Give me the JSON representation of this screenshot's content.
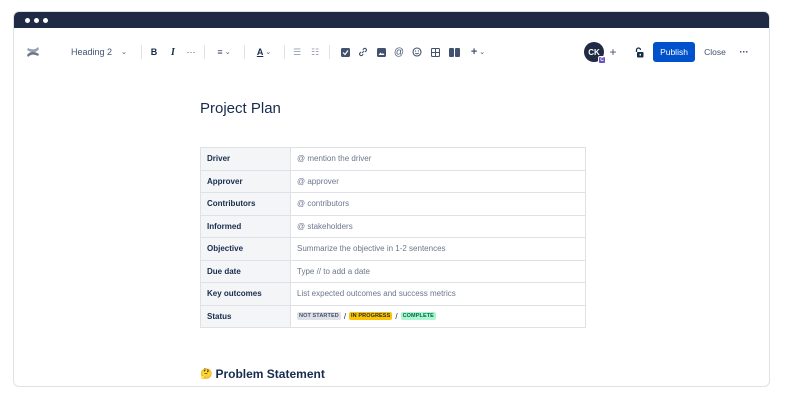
{
  "toolbar": {
    "heading_select": "Heading 2",
    "bold": "B",
    "italic": "I",
    "more": "···",
    "align": "≡",
    "text_color": "A",
    "bullet_list": "☰",
    "numbered_list": "☷",
    "insert": "+",
    "avatar_initials": "CK",
    "avatar_badge": "C",
    "invite": "+",
    "publish": "Publish",
    "close": "Close",
    "overflow": "···"
  },
  "page": {
    "title": "Project Plan"
  },
  "table": {
    "rows": [
      {
        "key": "Driver",
        "value": "@ mention the driver"
      },
      {
        "key": "Approver",
        "value": "@ approver"
      },
      {
        "key": "Contributors",
        "value": "@ contributors"
      },
      {
        "key": "Informed",
        "value": "@ stakeholders"
      },
      {
        "key": "Objective",
        "value": "Summarize the objective in 1-2 sentences"
      },
      {
        "key": "Due date",
        "value": "Type // to add a date"
      },
      {
        "key": "Key outcomes",
        "value": "List expected outcomes and success metrics"
      },
      {
        "key": "Status",
        "value": ""
      }
    ],
    "status": {
      "options": [
        "NOT STARTED",
        "IN PROGRESS",
        "COMPLETE"
      ],
      "separator": "/"
    }
  },
  "section": {
    "emoji": "🤔",
    "heading": "Problem Statement"
  },
  "colors": {
    "brand": "#0052cc",
    "titlebar": "#1f2a44",
    "lozenge_gray": "#dfe1e6",
    "lozenge_yellow": "#ffc400",
    "lozenge_green": "#abf5d1"
  }
}
